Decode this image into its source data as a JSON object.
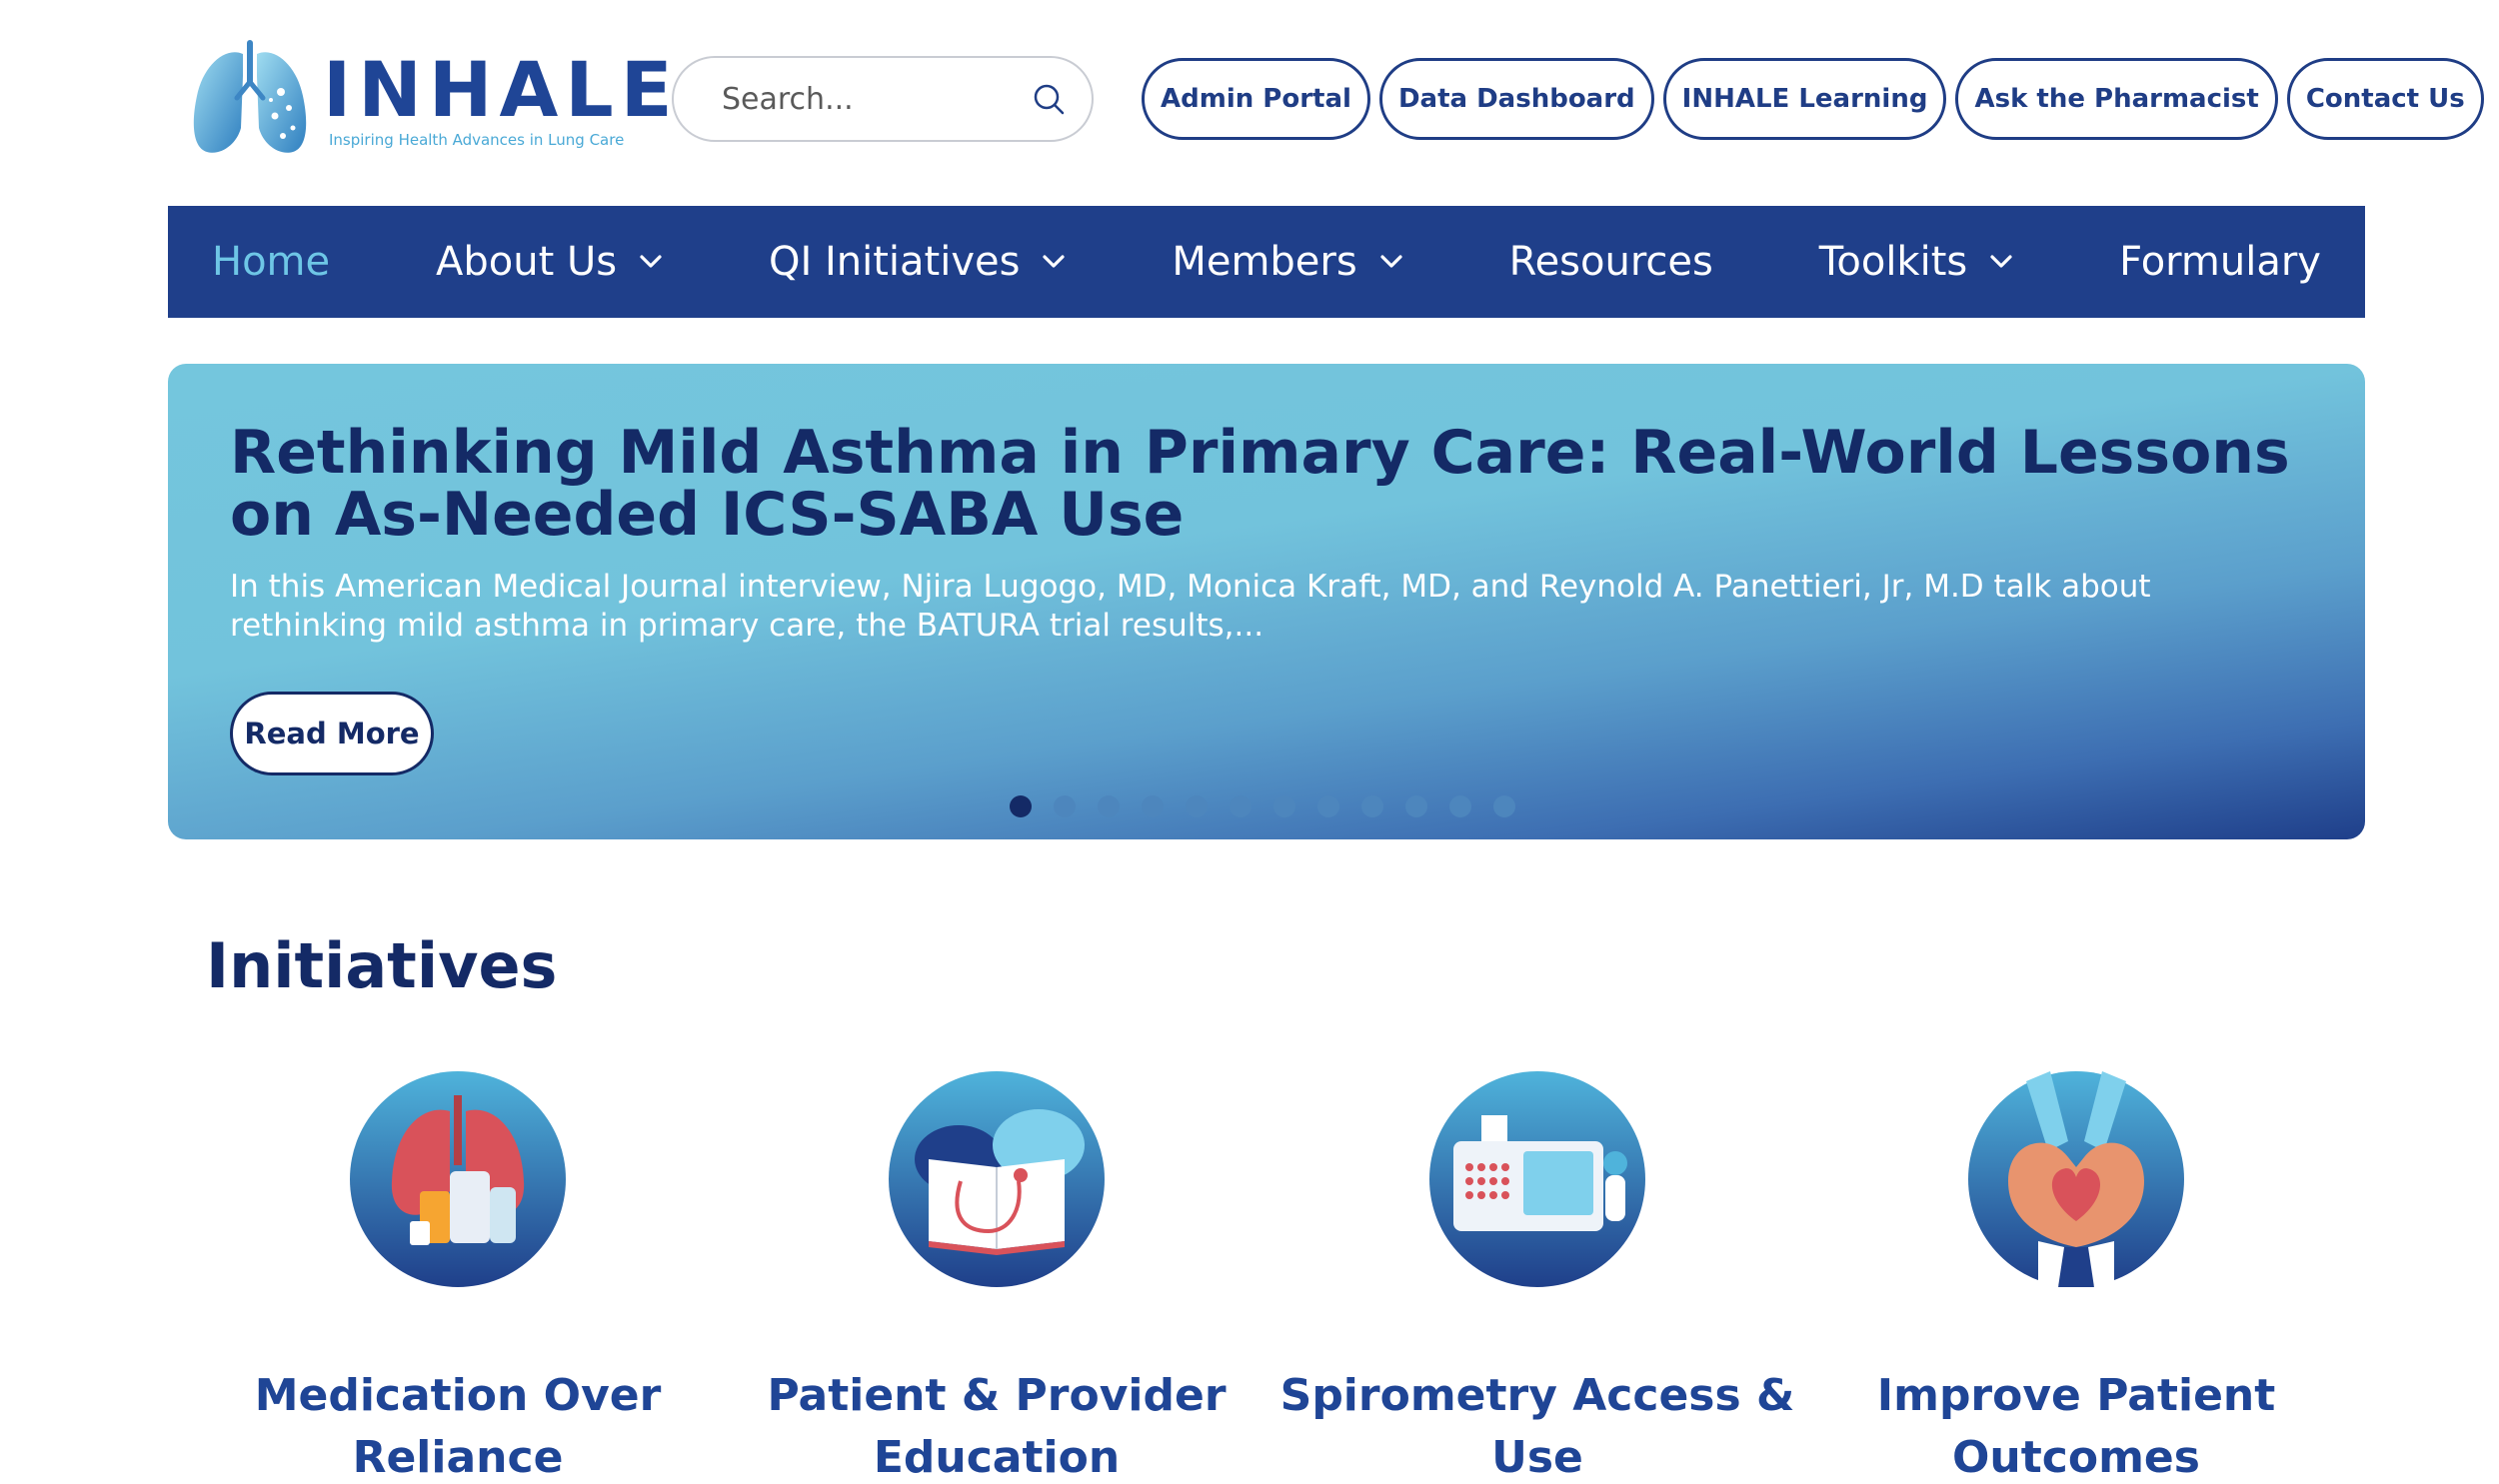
{
  "logo": {
    "word": "INHALE",
    "tagline": "Inspiring Health Advances in Lung Care"
  },
  "search": {
    "placeholder": "Search..."
  },
  "top_links": [
    "Admin Portal",
    "Data Dashboard",
    "INHALE Learning",
    "Ask the Pharmacist",
    "Contact Us"
  ],
  "nav": {
    "items": [
      {
        "label": "Home",
        "active": true,
        "dropdown": false
      },
      {
        "label": "About Us",
        "active": false,
        "dropdown": true
      },
      {
        "label": "QI Initiatives",
        "active": false,
        "dropdown": true
      },
      {
        "label": "Members",
        "active": false,
        "dropdown": true
      },
      {
        "label": "Resources",
        "active": false,
        "dropdown": false
      },
      {
        "label": "Toolkits",
        "active": false,
        "dropdown": true
      },
      {
        "label": "Formulary",
        "active": false,
        "dropdown": false
      }
    ]
  },
  "hero": {
    "title": "Rethinking Mild Asthma in Primary Care: Real-World Lessons on As-Needed ICS-SABA Use",
    "description": "In this American Medical Journal interview, Njira Lugogo, MD, Monica Kraft, MD, and Reynold A. Panettieri, Jr, M.D talk about rethinking mild asthma in primary care, the BATURA trial results,...",
    "read_more": "Read More",
    "slide_count": 12,
    "active_slide": 0
  },
  "initiatives": {
    "title": "Initiatives",
    "items": [
      {
        "label": "Medication Over Reliance",
        "icon": "lungs-medication-icon"
      },
      {
        "label": "Patient & Provider Education",
        "icon": "education-book-icon"
      },
      {
        "label": "Spirometry Access & Use",
        "icon": "spirometer-icon"
      },
      {
        "label": "Improve Patient Outcomes",
        "icon": "hands-heart-icon"
      }
    ]
  },
  "colors": {
    "primary": "#1f3f8a",
    "accent": "#6ec6e6",
    "dark_text": "#142a66",
    "heading_blue": "#1f4596"
  }
}
